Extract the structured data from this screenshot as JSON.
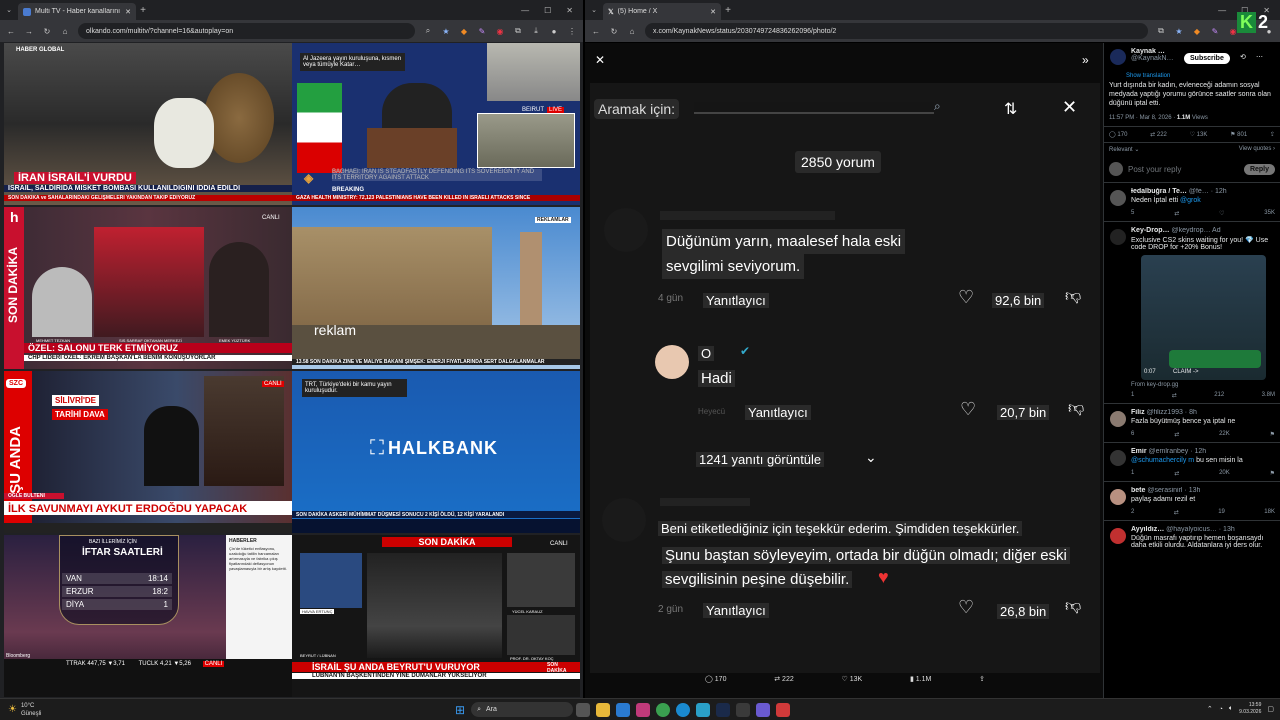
{
  "left": {
    "tab_title": "Multi TV - Haber kanallarını ay…",
    "url": "olkando.com/multitv/?channel=16&autoplay=on",
    "tiles": {
      "t1": {
        "logo": "HABER GLOBAL",
        "headline": "İRAN İSRAİL'İ VURDU",
        "subline": "İSRAİL, SALDIRIDA MİSKET BOMBASI KULLANILDIĞINI İDDİA EDİLDİ",
        "ticker": "SON DAKİKA  ve SAHALARINDAKİ GELİŞMELERİ YAKINDAN TAKİP EDİYORUZ"
      },
      "t2": {
        "caption": "Al Jazeera yayın kuruluşuna, kısmen veya tümüyle Katar…",
        "live": "LIVE",
        "place": "BEIRUT",
        "news1": "BAGHAEI: IRAN IS STEADFASTLY DEFENDING ITS SOVEREIGNTY AND ITS TERRITORY AGAINST ATTACK",
        "breaking": "BREAKING",
        "ticker": "GAZA HEALTH MINISTRY: 72,123 PALESTINIANS HAVE BEEN KILLED IN ISRAELI ATTACKS SINCE"
      },
      "t3": {
        "logo": "h",
        "side": "SON DAKİKA",
        "live": "CANLI",
        "n1": "MEHMET TEZKAN",
        "n2": "SIS SARRAF OKTAHAN MERKEZİ",
        "n3": "EMEK YÜZTÜRK",
        "headline": "ÖZEL: SALONU TERK ETMİYORUZ",
        "subline": "CHP LİDERİ ÖZEL: EKREM BAŞKAN'LA BENİM KONUŞUYORLAR"
      },
      "t4": {
        "ad_badge": "REKLAMLAR",
        "reklam": "reklam",
        "ticker": "13.58  SON DAKİKA  ZİNE VE MALİYE BAKANI ŞİMŞEK: ENERJİ FİYATLARINDA SERT DALGALANMALAR"
      },
      "t5": {
        "logo": "SZC",
        "live": "CANLI",
        "side": "ŞU ANDA",
        "box1": "SİLİVRİ'DE",
        "box2": "TARİHİ DAVA",
        "headline": "İLK SAVUNMAYI AYKUT ERDOĞDU YAPACAK",
        "sub": "ÖĞLE BÜLTENİ"
      },
      "t6": {
        "caption": "TRT, Türkiye'deki bir kamu yayın kuruluşudur.",
        "brand": "HALKBANK",
        "ticker": "SON DAKİKA  ASKERİ MÜHİMMAT DÜŞMESİ SONUCU 2 KİŞİ ÖLDÜ, 12 KİŞİ YARALANDI"
      },
      "t7": {
        "h1": "BAZI İLLERİMİZ İÇİN",
        "h2": "İFTAR SAATLERİ",
        "rows": [
          {
            "city": "VAN",
            "time": "18:14"
          },
          {
            "city": "ERZUR",
            "time": "18:2"
          },
          {
            "city": "DİYA",
            "time": "1"
          }
        ],
        "brand": "Bloomberg",
        "side_title": "HABERLER",
        "side_text": "Çin'de tüketici enflasyonu, uzakdoğu tatilin harcamaları artırmasıyla ve fabrika çıkış fiyatlarındaki deflasyonun yavaşlamasıyla bir artış kaydetti.",
        "m1": "TTRAK 447,75 ▼3,71",
        "m2": "TUCLK 4,21 ▼5,26",
        "m3": "CANLI"
      },
      "t8": {
        "banner": "SON DAKİKA",
        "live": "CANLI",
        "p1": "HAVVA ERTUNÇ",
        "p2": "YÜCEL KARAUZ",
        "p3": "PROF. DR. OKTAY KOÇ",
        "place": "BEYRUT / LÜBNAN",
        "headline": "İSRAİL ŞU ANDA BEYRUT'U VURUYOR",
        "subline": "LÜBNAN'IN BAŞKENTİNDEN YİNE DUMANLAR YÜKSELİYOR",
        "badge": "SON DAKİKA"
      }
    }
  },
  "right": {
    "tab_title": "(5) Home / X",
    "url": "x.com/KaynakNews/status/2030749724836262096/photo/2",
    "overlay": {
      "search_label": "Aramak için:",
      "count": "2850 yorum",
      "c1_text1": "Düğünüm yarın, maalesef hala eski",
      "c1_text2": "sevgilimi seviyorum.",
      "c1_time": "4 gün",
      "reply": "Yanıtlayıcı",
      "c1_likes": "92,6 bin",
      "c2_name": "O",
      "c2_text": "Hadi",
      "c2_time": "Heyecü",
      "c2_likes": "20,7 bin",
      "more": "1241 yanıtı görüntüle",
      "c3_text1": "Beni etiketlediğiniz için teşekkür ederim. Şimdiden teşekkürler.",
      "c3_text2": "Şunu baştan söyleyeyim, ortada bir düğün olmadı; diğer eski",
      "c3_text3": "sevgilisinin peşine düşebilir.",
      "c3_time": "2 gün",
      "c3_likes": "26,8 bin"
    },
    "bottom_stats": {
      "replies": "170",
      "reposts": "222",
      "likes": "13K",
      "views": "1.1M"
    },
    "side": {
      "author": "Kaynak …",
      "handle": "@KaynakN…",
      "subscribe": "Subscribe",
      "show_translation": "Show translation",
      "tweet": "Yurt dışında bir kadın, evleneceği adamın sosyal medyada yaptığı yorumu görünce saatler sonra olan düğünü iptal etti.",
      "time": "11:57 PM · Mar 8, 2026 · ",
      "views": "1.1M",
      "views_label": " Views",
      "stats": {
        "replies": "170",
        "reposts": "222",
        "likes": "13K",
        "bookmarks": "801"
      },
      "relevant": "Relevant ⌄",
      "view_quotes": "View quotes ›",
      "reply_placeholder": "Post your reply",
      "reply_btn": "Reply",
      "replies": [
        {
          "name": "Ɨedalbuğra / Te…",
          "meta": "@fe… · 12h",
          "text": "Neden İptal etti ",
          "mention": "@grok",
          "s": [
            "5",
            "",
            "",
            "35K"
          ]
        },
        {
          "name": "Key-Drop…",
          "meta": "@keydrop… Ad",
          "text": "Exclusive CS2 skins waiting for you! 💎 Use code DROP for +20% Bonus!",
          "mention": "",
          "s": [
            "1",
            "",
            "212",
            "3.8M"
          ]
        },
        {
          "name": "Filiz",
          "meta": "@filizz1993 · 8h",
          "text": "Fazla büyütmüş bence ya iptal ne",
          "mention": "",
          "s": [
            "6",
            "",
            "22K",
            ""
          ]
        },
        {
          "name": "Emir",
          "meta": "@emlranbey · 12h",
          "text": " bu sen misin la",
          "mention": "@schumachercily m",
          "s": [
            "1",
            "",
            "20K",
            ""
          ]
        },
        {
          "name": "bete",
          "meta": "@serasinirl · 13h",
          "text": "paylaş adamı rezil et",
          "mention": "",
          "s": [
            "2",
            "",
            "19",
            "18K"
          ]
        },
        {
          "name": "Ayyıldız…",
          "meta": "@hayalyoicus… · 13h",
          "text": "Düğün masrafı yaptırıp hemen boşansaydı daha etkili olurdu. Aldatanlara iyi ders olur.",
          "mention": "",
          "s": []
        }
      ],
      "ad_claim": "CLAIM ->",
      "ad_time": "0:07",
      "ad_from": "From key-drop.gg"
    },
    "corner_badge": "2"
  },
  "taskbar": {
    "temp": "10°C",
    "weather": "Güneşli",
    "search": "Ara",
    "time": "13:59",
    "date": "9.03.2026"
  }
}
